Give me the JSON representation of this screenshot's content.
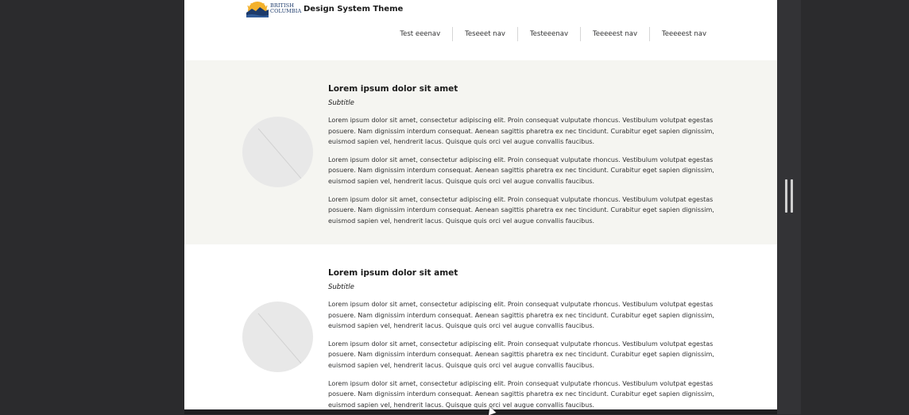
{
  "header": {
    "logo_text_line1": "BRITISH",
    "logo_text_line2": "COLUMBIA",
    "site_title": "Design System Theme",
    "nav": [
      {
        "label": "Test eeenav"
      },
      {
        "label": "Teseeet nav"
      },
      {
        "label": "Testeeenav"
      },
      {
        "label": "Teeeeest nav"
      },
      {
        "label": "Teeeeest nav"
      }
    ]
  },
  "sections": [
    {
      "title": "Lorem ipsum dolor sit amet",
      "subtitle": "Subtitle",
      "paragraphs": [
        "Lorem ipsum dolor sit amet, consectetur adipiscing elit. Proin consequat vulputate rhoncus. Vestibulum volutpat egestas posuere. Nam dignissim interdum consequat. Aenean sagittis pharetra ex nec tincidunt. Curabitur eget sapien dignissim, euismod sapien vel, hendrerit lacus. Quisque quis orci vel augue convallis faucibus.",
        "Lorem ipsum dolor sit amet, consectetur adipiscing elit. Proin consequat vulputate rhoncus. Vestibulum volutpat egestas posuere. Nam dignissim interdum consequat. Aenean sagittis pharetra ex nec tincidunt. Curabitur eget sapien dignissim, euismod sapien vel, hendrerit lacus. Quisque quis orci vel augue convallis faucibus.",
        "Lorem ipsum dolor sit amet, consectetur adipiscing elit. Proin consequat vulputate rhoncus. Vestibulum volutpat egestas posuere. Nam dignissim interdum consequat. Aenean sagittis pharetra ex nec tincidunt. Curabitur eget sapien dignissim, euismod sapien vel, hendrerit lacus. Quisque quis orci vel augue convallis faucibus."
      ]
    },
    {
      "title": "Lorem ipsum dolor sit amet",
      "subtitle": "Subtitle",
      "paragraphs": [
        "Lorem ipsum dolor sit amet, consectetur adipiscing elit. Proin consequat vulputate rhoncus. Vestibulum volutpat egestas posuere. Nam dignissim interdum consequat. Aenean sagittis pharetra ex nec tincidunt. Curabitur eget sapien dignissim, euismod sapien vel, hendrerit lacus. Quisque quis orci vel augue convallis faucibus.",
        "Lorem ipsum dolor sit amet, consectetur adipiscing elit. Proin consequat vulputate rhoncus. Vestibulum volutpat egestas posuere. Nam dignissim interdum consequat. Aenean sagittis pharetra ex nec tincidunt. Curabitur eget sapien dignissim, euismod sapien vel, hendrerit lacus. Quisque quis orci vel augue convallis faucibus.",
        "Lorem ipsum dolor sit amet, consectetur adipiscing elit. Proin consequat vulputate rhoncus. Vestibulum volutpat egestas posuere. Nam dignissim interdum consequat. Aenean sagittis pharetra ex nec tincidunt. Curabitur eget sapien dignissim, euismod sapien vel, hendrerit lacus. Quisque quis orci vel augue convallis faucibus."
      ]
    }
  ],
  "colors": {
    "page_bg": "#2b2b2d",
    "alt_section_bg": "#f5f5f1",
    "avatar_bg": "#e8e8e8",
    "brand_blue": "#1c3a6b",
    "brand_gold": "#f3b12b"
  }
}
